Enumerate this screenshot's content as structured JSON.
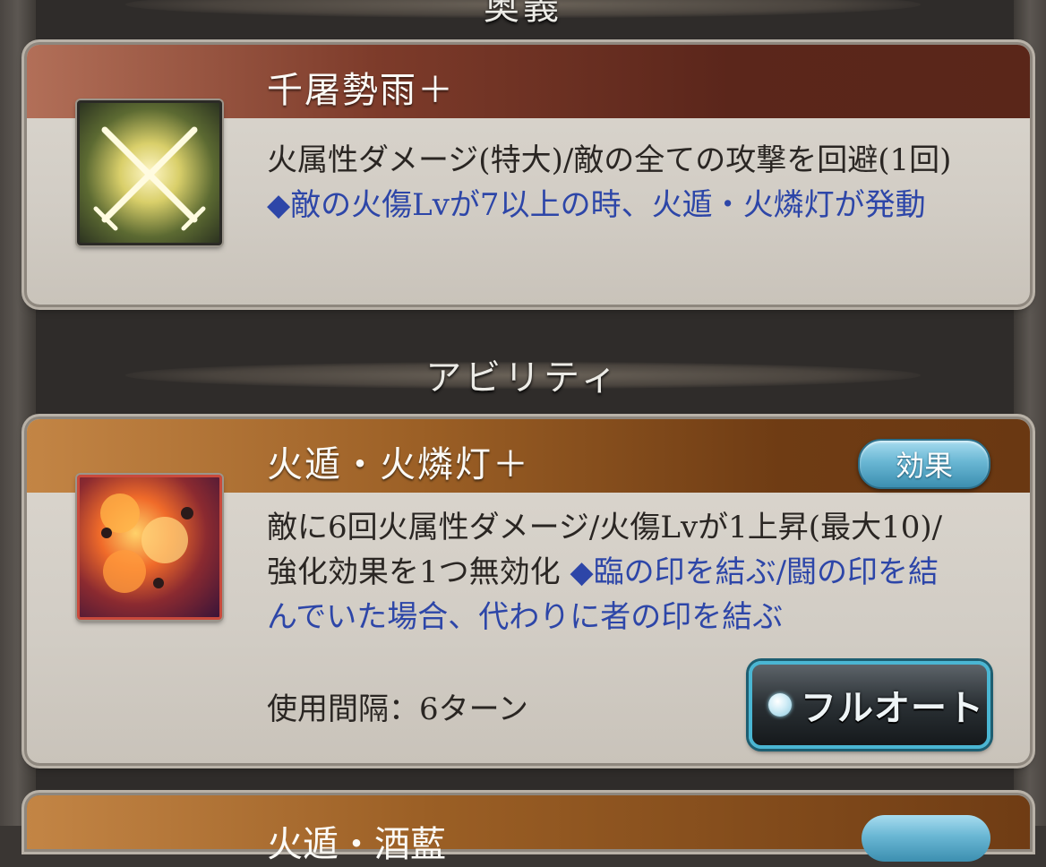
{
  "sections": {
    "ougi_label": "奥義",
    "ability_label": "アビリティ"
  },
  "ougi": {
    "title": "千屠勢雨＋",
    "icon": "crossed-swords-icon",
    "desc_main": "火属性ダメージ(特大)/敵の全ての攻撃を回避(1回)",
    "desc_note": "◆敵の火傷Lvが7以上の時、火遁・火燐灯が発動"
  },
  "ability": {
    "title": "火遁・火燐灯＋",
    "icon": "fire-burst-icon",
    "effect_button": "効果",
    "desc_main": "敵に6回火属性ダメージ/火傷Lvが1上昇(最大10)/強化効果を1つ無効化",
    "desc_note": "◆臨の印を結ぶ/闘の印を結んでいた場合、代わりに者の印を結ぶ",
    "cooldown": "使用間隔：6ターン",
    "fullauto_button": "フルオート"
  },
  "next_ability": {
    "title": "火遁・酒藍"
  },
  "colors": {
    "note_blue": "#2d46a8",
    "ougi_bar": "#7d3b2a",
    "ability_bar": "#9b5f25",
    "button_cyan": "#4ab6d3"
  }
}
